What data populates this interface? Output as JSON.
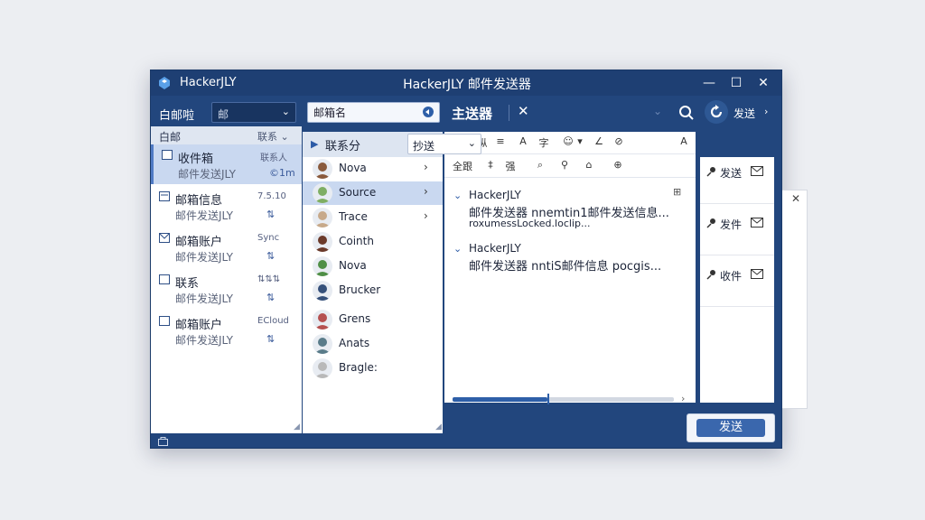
{
  "window": {
    "app_name": "HackerJLY",
    "title": "HackerJLY 邮件发送器",
    "minimize": "—",
    "maximize": "☐",
    "close": "✕"
  },
  "toolbar": {
    "left_label": "白邮啦",
    "folder_select_value": "邮",
    "folder_select_chevron": "⌄",
    "search_value": "邮箱名",
    "compose_title": "主送器",
    "compose_close": "✕",
    "dim_chevron": "⌄",
    "more_label": "发送",
    "more_chevron": "›"
  },
  "folders": {
    "header_left": "白邮",
    "header_right": "联系 ⌄",
    "items": [
      {
        "name": "收件箱",
        "sub": "邮件发送JLY",
        "meta": "联系人",
        "meta2": "©1m",
        "selected": true
      },
      {
        "name": "邮箱信息",
        "sub": "邮件发送JLY",
        "meta": "7.5.10",
        "meta2": "⇅"
      },
      {
        "name": "邮箱账户",
        "sub": "邮件发送JLY",
        "meta": "Sync",
        "meta2": "⇅"
      },
      {
        "name": "联系",
        "sub": "邮件发送JLY",
        "meta": "⇅⇅⇅",
        "meta2": "⇅"
      },
      {
        "name": "邮箱账户",
        "sub": "邮件发送JLY",
        "meta": "ECloud",
        "meta2": "⇅"
      }
    ],
    "footer_a": "n",
    "footer_b": "⇅"
  },
  "contacts": {
    "header": "联系分",
    "header_chevron": "⌃",
    "items": [
      {
        "name": "Nova",
        "arrow": "›",
        "color": "#8a5a3c"
      },
      {
        "name": "Source",
        "arrow": "›",
        "color": "#7fae63",
        "selected": true
      },
      {
        "name": "Trace",
        "arrow": "›",
        "color": "#c7a98a"
      },
      {
        "name": "Cointh",
        "arrow": "",
        "color": "#6b3a2a"
      },
      {
        "name": "Nova",
        "arrow": "",
        "color": "#4f8f46"
      },
      {
        "name": "Brucker",
        "arrow": "",
        "color": "#35507a"
      },
      {
        "name": "Grens",
        "arrow": "",
        "color": "#b55050"
      },
      {
        "name": "Anats",
        "arrow": "",
        "color": "#5a7c8a"
      },
      {
        "name": "Bragle:",
        "arrow": "",
        "color": "#b9b9b9"
      }
    ]
  },
  "compose": {
    "format_row1": [
      "≡",
      "纵",
      "≡",
      "A",
      "字",
      "☺",
      "▾",
      "∠",
      "⊘",
      "A"
    ],
    "format_row2": [
      "全跟",
      "‡",
      "强",
      "⌕",
      "⚲",
      "⌂",
      "⊕"
    ],
    "cc_value": "抄送",
    "cc_chevron": "⌄",
    "threads": [
      {
        "from": "HackerJLY",
        "line1": "邮件发送器 nnemtin1邮件发送信息...",
        "line2": "roxumessLocked.loclip...",
        "toggle": "⌄"
      },
      {
        "from": "HackerJLY",
        "line1": "邮件发送器 nntiS邮件信息 pocgis...",
        "line2": "",
        "toggle": "⌄"
      }
    ],
    "attach_icon": "⊞",
    "progress": 0.43,
    "progress_chevron": "›"
  },
  "recipients": [
    {
      "label": "发送"
    },
    {
      "label": "发件"
    },
    {
      "label": "收件"
    }
  ],
  "send_button": "发送",
  "side_card_close": "✕",
  "colors": {
    "window_bg": "#22467d",
    "accent": "#3a67ad",
    "selection": "#c9d8f0"
  }
}
